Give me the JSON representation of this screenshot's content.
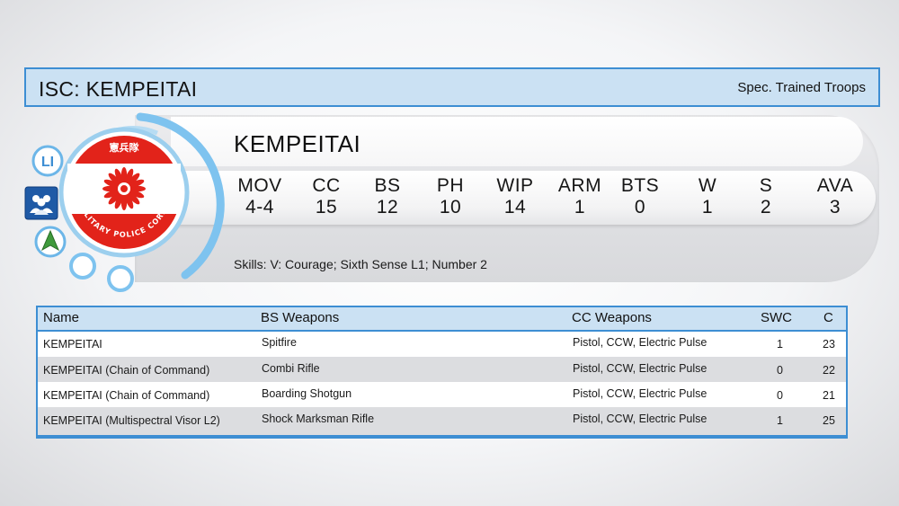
{
  "header": {
    "title": "ISC: KEMPEITAI",
    "unit_type": "Spec. Trained Troops"
  },
  "profile": {
    "name": "KEMPEITAI",
    "stats": [
      {
        "label": "MOV",
        "value": "4-4"
      },
      {
        "label": "CC",
        "value": "15"
      },
      {
        "label": "BS",
        "value": "12"
      },
      {
        "label": "PH",
        "value": "10"
      },
      {
        "label": "WIP",
        "value": "14"
      },
      {
        "label": "ARM",
        "value": "1"
      },
      {
        "label": "BTS",
        "value": "0"
      },
      {
        "label": "W",
        "value": "1"
      },
      {
        "label": "S",
        "value": "2"
      },
      {
        "label": "AVA",
        "value": "3"
      }
    ],
    "skills": "Skills: V: Courage; Sixth Sense L1; Number 2"
  },
  "emblem": {
    "kanji": "憲兵隊",
    "ring_text": "MILITARY POLICE CORPS"
  },
  "side_icons": {
    "li_label": "LI",
    "type_icons": [
      "li-badge-icon",
      "fireteam-icon",
      "forward-deploy-icon"
    ]
  },
  "table": {
    "headers": {
      "name": "Name",
      "bs": "BS Weapons",
      "cc": "CC Weapons",
      "swc": "SWC",
      "c": "C"
    },
    "rows": [
      {
        "name": "KEMPEITAI",
        "bs": "Spitfire",
        "cc": "Pistol, CCW, Electric Pulse",
        "swc": "1",
        "c": "23"
      },
      {
        "name": "KEMPEITAI (Chain of Command)",
        "bs": "Combi Rifle",
        "cc": "Pistol, CCW, Electric Pulse",
        "swc": "0",
        "c": "22"
      },
      {
        "name": "KEMPEITAI (Chain of Command)",
        "bs": "Boarding Shotgun",
        "cc": "Pistol, CCW, Electric Pulse",
        "swc": "0",
        "c": "21"
      },
      {
        "name": "KEMPEITAI (Multispectral Visor L2)",
        "bs": "Shock Marksman Rifle",
        "cc": "Pistol, CCW, Electric Pulse",
        "swc": "1",
        "c": "25"
      }
    ]
  },
  "colors": {
    "accent_blue": "#3d8ed3",
    "header_fill": "#cbe1f3",
    "emblem_red": "#e2231a",
    "ring_blue": "#7ec3ef"
  }
}
